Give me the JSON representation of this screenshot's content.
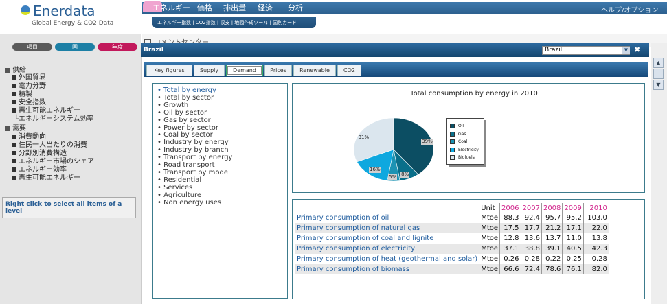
{
  "brand": {
    "name": "Enerdata",
    "tagline": "Global Energy & CO2 Data",
    "logo_color": "#2a5f95"
  },
  "topnav": {
    "items": [
      "エネルギー",
      "価格",
      "排出量",
      "経済",
      "分析"
    ],
    "active": "分析",
    "help": "ヘルプ/オプション",
    "subnav": "エネルギー指数 | CO2指数 | 収支 | 地図作成ツール | 国別カード"
  },
  "sidebar": {
    "pills": [
      {
        "label": "項目",
        "color": "#555555"
      },
      {
        "label": "国",
        "color": "#1c7fa5"
      },
      {
        "label": "年度",
        "color": "#c2185b"
      }
    ],
    "tree": [
      {
        "label": "供給",
        "level": 0
      },
      {
        "label": "外国貿易",
        "level": 1
      },
      {
        "label": "電力分野",
        "level": 1
      },
      {
        "label": "精製",
        "level": 1
      },
      {
        "label": "安全指数",
        "level": 1
      },
      {
        "label": "再生可能エネルギー",
        "level": 1
      },
      {
        "label": "エネルギーシステム効率",
        "level": 2
      },
      {
        "label": "需要",
        "level": 0
      },
      {
        "label": "消費動向",
        "level": 1
      },
      {
        "label": "住民一人当たりの消費",
        "level": 1
      },
      {
        "label": "分野別消費構造",
        "level": 1
      },
      {
        "label": "エネルギー市場のシェア",
        "level": 1
      },
      {
        "label": "エネルギー効率",
        "level": 1
      },
      {
        "label": "再生可能エネルギー",
        "level": 1
      }
    ],
    "hint": "Right click to select all items of a level"
  },
  "dialog": {
    "behind_title": "コメントセンター",
    "title": "Brazil",
    "country_selected": "Brazil",
    "close": "✖",
    "tabs": [
      "Key figures",
      "Supply",
      "Demand",
      "Prices",
      "Renewable",
      "CO2"
    ],
    "active_tab": "Demand"
  },
  "indicator_list": [
    "Total by energy",
    "Total by sector",
    "Growth",
    "Oil by sector",
    "Gas by sector",
    "Power by sector",
    "Coal by sector",
    "Industry by energy",
    "Industry by branch",
    "Transport by energy",
    "Road transport",
    "Transport by mode",
    "Residential",
    "Services",
    "Agriculture",
    "Non energy uses"
  ],
  "chart_data": {
    "type": "pie",
    "title": "Total consumption by energy in 2010",
    "categories": [
      "Oil",
      "Gas",
      "Coal",
      "Electricity",
      "Biofuels"
    ],
    "values": [
      39,
      8,
      5,
      16,
      31
    ],
    "labels": [
      "39%",
      "8%",
      "5%",
      "16%",
      "31%"
    ],
    "colors": [
      "#0c4e63",
      "#0a6f8a",
      "#1c93b3",
      "#0ea8df",
      "#dbe6ee"
    ],
    "legend": "right"
  },
  "table": {
    "unit_header": "Unit",
    "years": [
      "2006",
      "2007",
      "2008",
      "2009",
      "2010"
    ],
    "rows": [
      {
        "label": "Primary consumption of oil",
        "unit": "Mtoe",
        "values": [
          "88.3",
          "92.4",
          "95.7",
          "95.2",
          "103.0"
        ]
      },
      {
        "label": "Primary consumption of natural gas",
        "unit": "Mtoe",
        "values": [
          "17.5",
          "17.7",
          "21.2",
          "17.1",
          "22.0"
        ]
      },
      {
        "label": "Primary consumption of coal and lignite",
        "unit": "Mtoe",
        "values": [
          "12.8",
          "13.6",
          "13.7",
          "11.0",
          "13.8"
        ]
      },
      {
        "label": "Primary consumption of electricity",
        "unit": "Mtoe",
        "values": [
          "37.1",
          "38.8",
          "39.1",
          "40.5",
          "42.3"
        ]
      },
      {
        "label": "Primary consumption of heat (geothermal and solar)",
        "unit": "Mtoe",
        "values": [
          "0.26",
          "0.28",
          "0.22",
          "0.25",
          "0.28"
        ]
      },
      {
        "label": "Primary consumption of biomass",
        "unit": "Mtoe",
        "values": [
          "66.6",
          "72.4",
          "78.6",
          "76.1",
          "82.0"
        ]
      }
    ]
  }
}
